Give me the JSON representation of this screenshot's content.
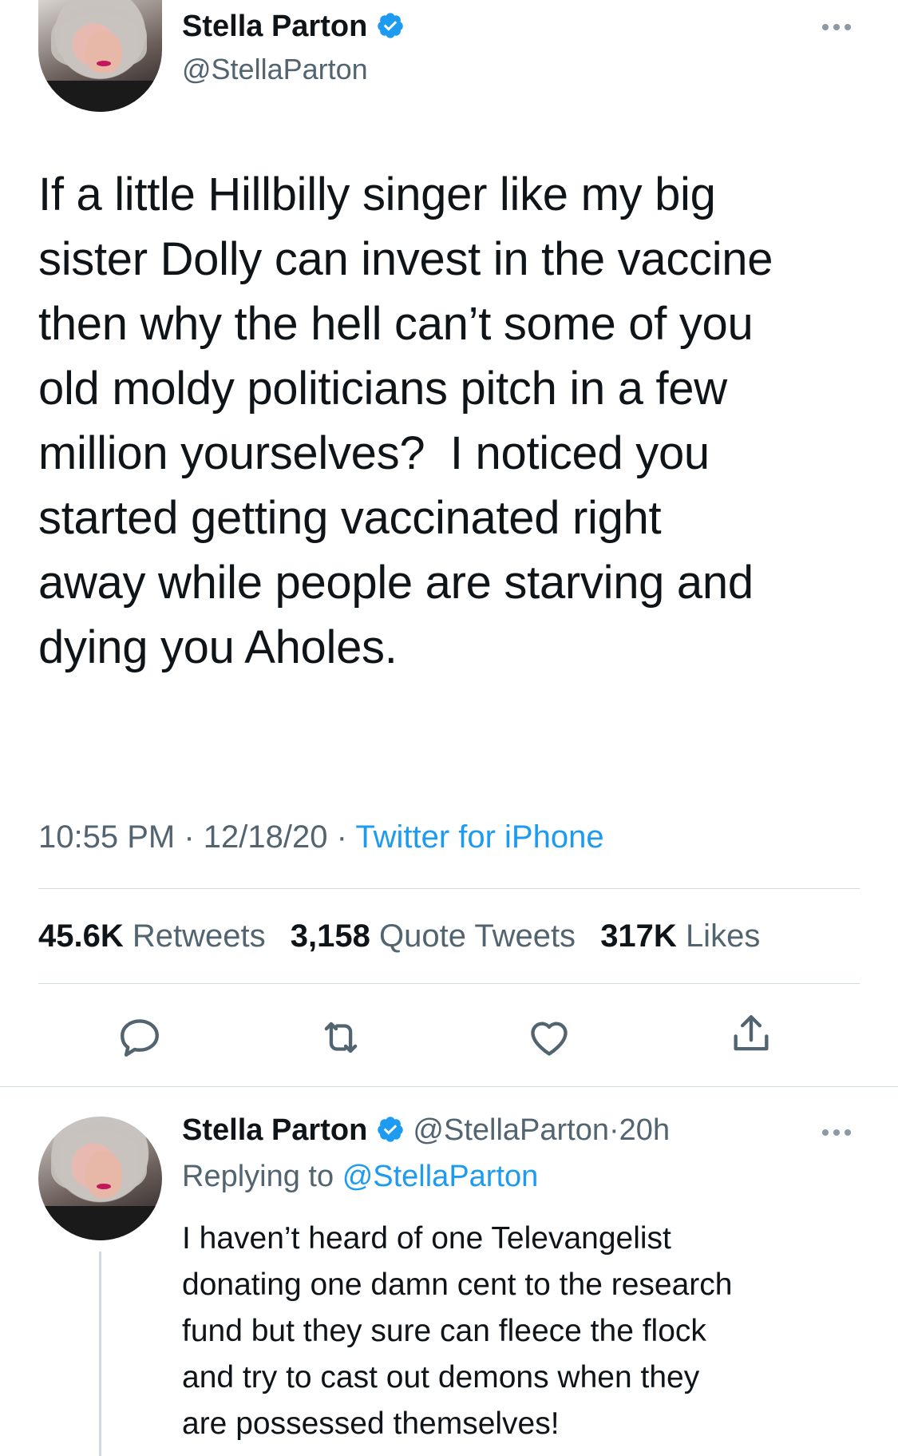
{
  "main_tweet": {
    "author": {
      "name": "Stella Parton",
      "handle": "@StellaParton",
      "verified": true
    },
    "text": "If a little Hillbilly singer like my big\nsister Dolly can invest in the vaccine\nthen why the hell can’t some of you\nold moldy politicians pitch in a few\nmillion yourselves?  I noticed you\nstarted getting vaccinated right\naway while people are starving and\ndying you Aholes.",
    "time": "10:55 PM",
    "date": "12/18/20",
    "separator": "·",
    "source": "Twitter for iPhone",
    "stats": {
      "retweets_count": "45.6K",
      "retweets_label": "Retweets",
      "quotes_count": "3,158",
      "quotes_label": "Quote Tweets",
      "likes_count": "317K",
      "likes_label": "Likes"
    },
    "actions": [
      "reply-icon",
      "retweet-icon",
      "like-icon",
      "share-icon"
    ]
  },
  "reply_tweet": {
    "author": {
      "name": "Stella Parton",
      "handle": "@StellaParton",
      "verified": true
    },
    "age": "20h",
    "separator": "·",
    "replying_prefix": "Replying to",
    "replying_to": "@StellaParton",
    "text": "I haven’t heard of one Televangelist\ndonating one damn cent to the research\nfund but they sure can fleece the flock\nand try to cast out demons when they\nare possessed themselves!"
  },
  "colors": {
    "text": "#0f1419",
    "secondary": "#536471",
    "link": "#1d9bf0",
    "divider": "#cfd9de"
  }
}
